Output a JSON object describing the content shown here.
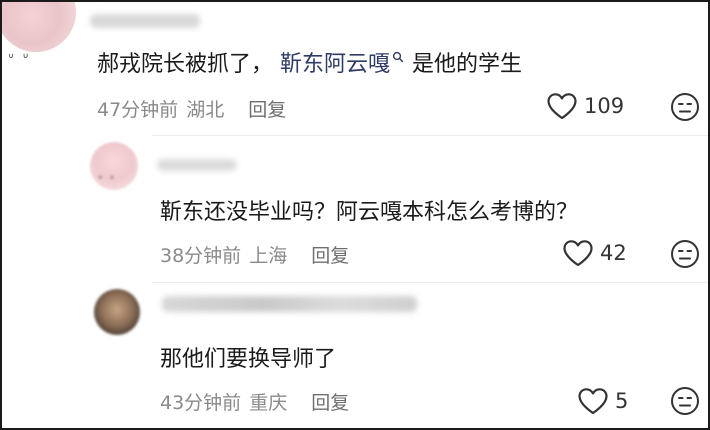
{
  "comments": [
    {
      "text_before": "郝戎院长被抓了，",
      "mention": "靳东阿云嘎",
      "text_after": "是他的学生",
      "time": "47分钟前",
      "location": "湖北",
      "reply_label": "回复",
      "likes": "109"
    },
    {
      "text": "靳东还没毕业吗？阿云嘎本科怎么考博的？",
      "time": "38分钟前",
      "location": "上海",
      "reply_label": "回复",
      "likes": "42"
    },
    {
      "text": "那他们要换导师了",
      "time": "43分钟前",
      "location": "重庆",
      "reply_label": "回复",
      "likes": "5"
    }
  ],
  "avatar_faces": [
    "ᐡ ᐡ",
    "ᐡ ᐡ"
  ],
  "colors": {
    "text": "#1a1a1a",
    "meta": "#8a8a8a",
    "mention": "#2f3b67",
    "border": "#1a1a1a"
  },
  "icons": {
    "like": "heart-outline-icon",
    "dislike": "neutral-face-icon",
    "mention": "search-icon"
  }
}
